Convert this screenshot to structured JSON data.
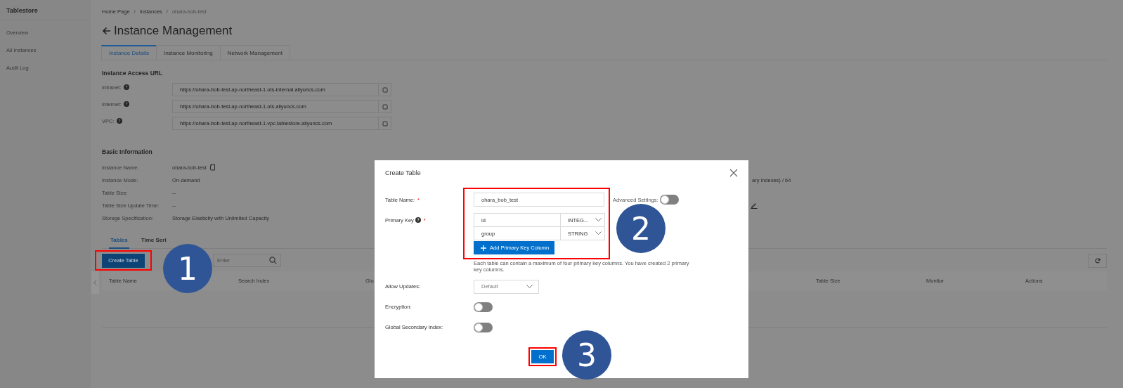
{
  "sidebar": {
    "title": "Tablestore",
    "items": [
      {
        "label": "Overview",
        "selected": false
      },
      {
        "label": "All Instances",
        "selected": false
      },
      {
        "label": "Audit Log",
        "selected": false
      }
    ]
  },
  "breadcrumb": [
    {
      "label": "Home Page",
      "kind": "link"
    },
    {
      "label": "/",
      "kind": "separator"
    },
    {
      "label": "Instances",
      "kind": "link"
    },
    {
      "label": "/",
      "kind": "separator"
    },
    {
      "label": "ohara-bob-test",
      "kind": "current"
    }
  ],
  "page_title": "Instance Management",
  "tabs": [
    {
      "label": "Instance Details",
      "selected": true
    },
    {
      "label": "Instance Monitoring",
      "selected": false
    },
    {
      "label": "Network Management",
      "selected": false
    }
  ],
  "access_url": {
    "heading": "Instance Access URL",
    "rows": [
      {
        "label": "Intranet:",
        "value": "https://ohara-bob-test.ap-northeast-1.ots-internal.aliyuncs.com"
      },
      {
        "label": "Internet:",
        "value": "https://ohara-bob-test.ap-northeast-1.ots.aliyuncs.com"
      },
      {
        "label": "VPC:",
        "value": "https://ohara-bob-test.ap-northeast-1.vpc.tablestore.aliyuncs.com"
      }
    ]
  },
  "basic_info": {
    "heading": "Basic Information",
    "rows": [
      {
        "label": "Instance Name:",
        "value": "ohara-bob-test",
        "kind": "copy"
      },
      {
        "label": "Instance Mode:",
        "value": "On-demand",
        "kind": "text",
        "right_text": "ary indexes) / 64"
      },
      {
        "label": "Table Size:",
        "value": "--",
        "kind": "text"
      },
      {
        "label": "Table Size Update Time:",
        "value": "--",
        "kind": "edit"
      },
      {
        "label": "Storage Specification:",
        "value": "Storage Elasticity with Unlimited Capacity",
        "kind": "text"
      }
    ]
  },
  "table_tabs": [
    {
      "label": "Tables",
      "selected": true
    },
    {
      "label": "Time Seri",
      "selected": false
    }
  ],
  "create_button": "Create Table",
  "search": {
    "placeholder": "Enter"
  },
  "table": {
    "columns": [
      "Table Name",
      "Search Index",
      "Glo",
      "Table Size",
      "Monitor",
      "Actions"
    ]
  },
  "dialog": {
    "title": "Create Table",
    "table_name": {
      "label": "Table Name:",
      "required_mark": "*",
      "value": "ohara_bob_test"
    },
    "advanced_settings": {
      "label": "Advanced Settings:",
      "on": false
    },
    "primary_key": {
      "label": "Primary Key",
      "required_mark": "*",
      "columns": [
        {
          "name": "id",
          "type": "INTEG..."
        },
        {
          "name": "group",
          "type": "STRING"
        }
      ],
      "add_button": "Add Primary Key Column",
      "hint": "Each table can contain a maximum of four primary key columns. You have created 2 primary key columns."
    },
    "allow_updates": {
      "label": "Allow Updates:",
      "value": "Default"
    },
    "encryption": {
      "label": "Encryption:",
      "on": false
    },
    "global_secondary_index": {
      "label": "Global Secondary Index:",
      "on": false
    },
    "ok_button": "OK"
  },
  "steps": [
    "1",
    "2",
    "3"
  ]
}
